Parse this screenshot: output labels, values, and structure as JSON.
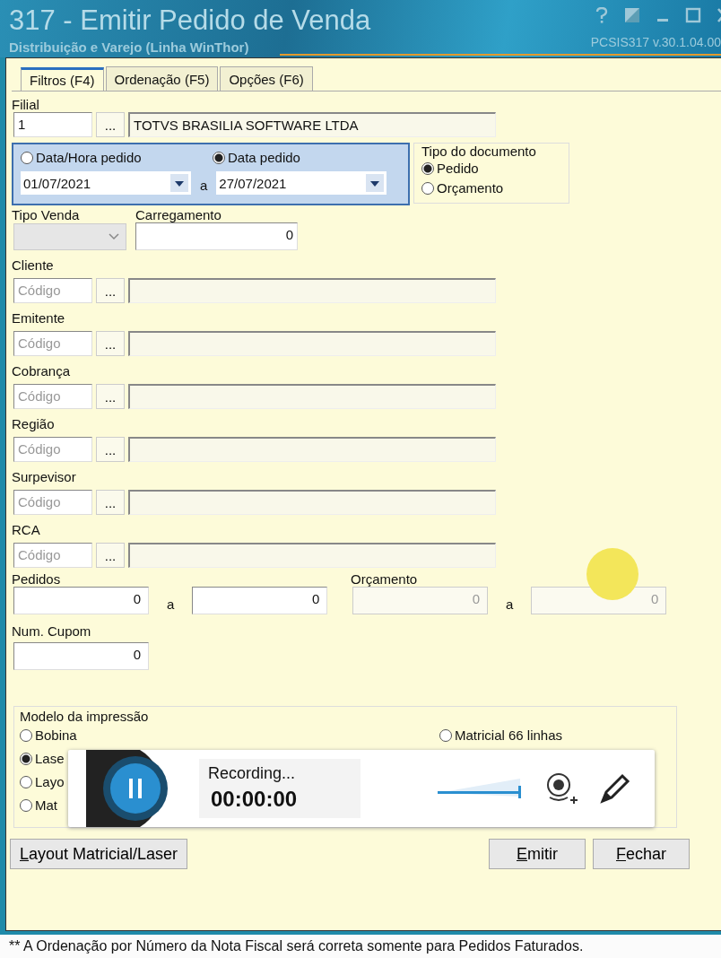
{
  "window": {
    "title": "317 - Emitir Pedido de Venda",
    "subtitle": "Distribuição e Varejo (Linha WinThor)",
    "version": "PCSIS317  v.30.1.04.00"
  },
  "tabs": [
    {
      "label": "Filtros (F4)",
      "selected": true
    },
    {
      "label": "Ordenação (F5)",
      "selected": false
    },
    {
      "label": "Opções (F6)",
      "selected": false
    }
  ],
  "filial": {
    "label": "Filial",
    "code": "1",
    "button": "...",
    "description": "TOTVS BRASILIA SOFTWARE LTDA"
  },
  "date_filter": {
    "options": [
      {
        "label": "Data/Hora pedido",
        "selected": false
      },
      {
        "label": "Data pedido",
        "selected": true
      }
    ],
    "from": "01/07/2021",
    "separator": "a",
    "to": "27/07/2021"
  },
  "document_type": {
    "title": "Tipo do documento",
    "options": [
      {
        "label": "Pedido",
        "selected": true
      },
      {
        "label": "Orçamento",
        "selected": false
      }
    ]
  },
  "tipo_venda": {
    "label": "Tipo Venda",
    "disabled": true
  },
  "carregamento": {
    "label": "Carregamento",
    "value": "0"
  },
  "lookups": [
    {
      "label": "Cliente",
      "placeholder": "Código",
      "button": "..."
    },
    {
      "label": "Emitente",
      "placeholder": "Código",
      "button": "..."
    },
    {
      "label": "Cobrança",
      "placeholder": "Código",
      "button": "..."
    },
    {
      "label": "Região",
      "placeholder": "Código",
      "button": "..."
    },
    {
      "label": "Surpevisor",
      "placeholder": "Código",
      "button": "..."
    },
    {
      "label": "RCA",
      "placeholder": "Código",
      "button": "..."
    }
  ],
  "ranges": [
    {
      "label": "Pedidos",
      "from": "0",
      "separator": "a",
      "to": "0",
      "disabled": false
    },
    {
      "label": "Orçamento",
      "from": "0",
      "separator": "a",
      "to": "0",
      "disabled": true
    }
  ],
  "num_cupom": {
    "label": "Num. Cupom",
    "value": "0"
  },
  "print_model": {
    "title": "Modelo da impressão",
    "options": [
      {
        "label": "Bobina",
        "selected": false
      },
      {
        "label": "Lase",
        "selected": true
      },
      {
        "label": "Layo",
        "selected": false
      },
      {
        "label": "Mat",
        "selected": false
      },
      {
        "label": "Matricial 66 linhas",
        "selected": false
      }
    ]
  },
  "buttons": [
    {
      "label": "Layout Matricial/Laser"
    },
    {
      "label": "Emitir"
    },
    {
      "label": "Fechar"
    }
  ],
  "recording": {
    "status": "Recording...",
    "time": "00:00:00",
    "level": 1
  },
  "footer": "** A Ordenação por Número da Nota Fiscal será correta somente para Pedidos Faturados."
}
